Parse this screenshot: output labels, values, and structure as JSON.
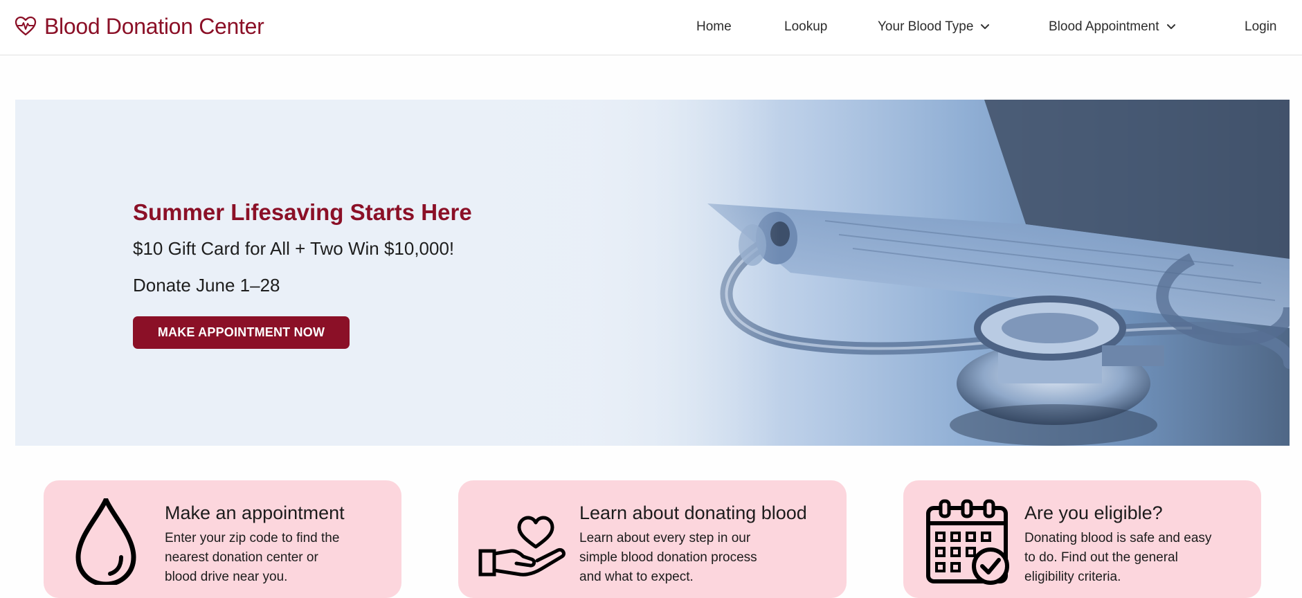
{
  "header": {
    "brand": {
      "title": "Blood Donation Center",
      "icon": "heartbeat-icon"
    },
    "nav": [
      {
        "label": "Home",
        "has_dropdown": false
      },
      {
        "label": "Lookup",
        "has_dropdown": false
      },
      {
        "label": "Your Blood Type",
        "has_dropdown": true
      },
      {
        "label": "Blood Appointment",
        "has_dropdown": true
      },
      {
        "label": "Login",
        "has_dropdown": false
      }
    ]
  },
  "hero": {
    "title": "Summer Lifesaving Starts Here",
    "line1": "$10 Gift Card for All + Two Win $10,000!",
    "line2": "Donate June 1–28",
    "cta_label": "MAKE APPOINTMENT NOW",
    "image": "stethoscope-laptop-photo"
  },
  "cards": [
    {
      "icon": "blood-drop-icon",
      "title": "Make an appointment",
      "desc_lines": [
        "Enter your zip code to find the",
        "nearest donation center or",
        "blood drive near you."
      ]
    },
    {
      "icon": "heart-in-hand-icon",
      "title": "Learn about donating blood",
      "desc_lines": [
        "Learn about every step in our",
        "simple blood donation process",
        "and what to expect."
      ]
    },
    {
      "icon": "calendar-check-icon",
      "title": "Are you eligible?",
      "desc_lines": [
        "Donating blood is safe and easy",
        "to do. Find out the general",
        "eligibility criteria."
      ]
    }
  ],
  "colors": {
    "brand": "#8b1027",
    "card_bg": "#fcd6dd",
    "text": "#1c1c1c"
  }
}
